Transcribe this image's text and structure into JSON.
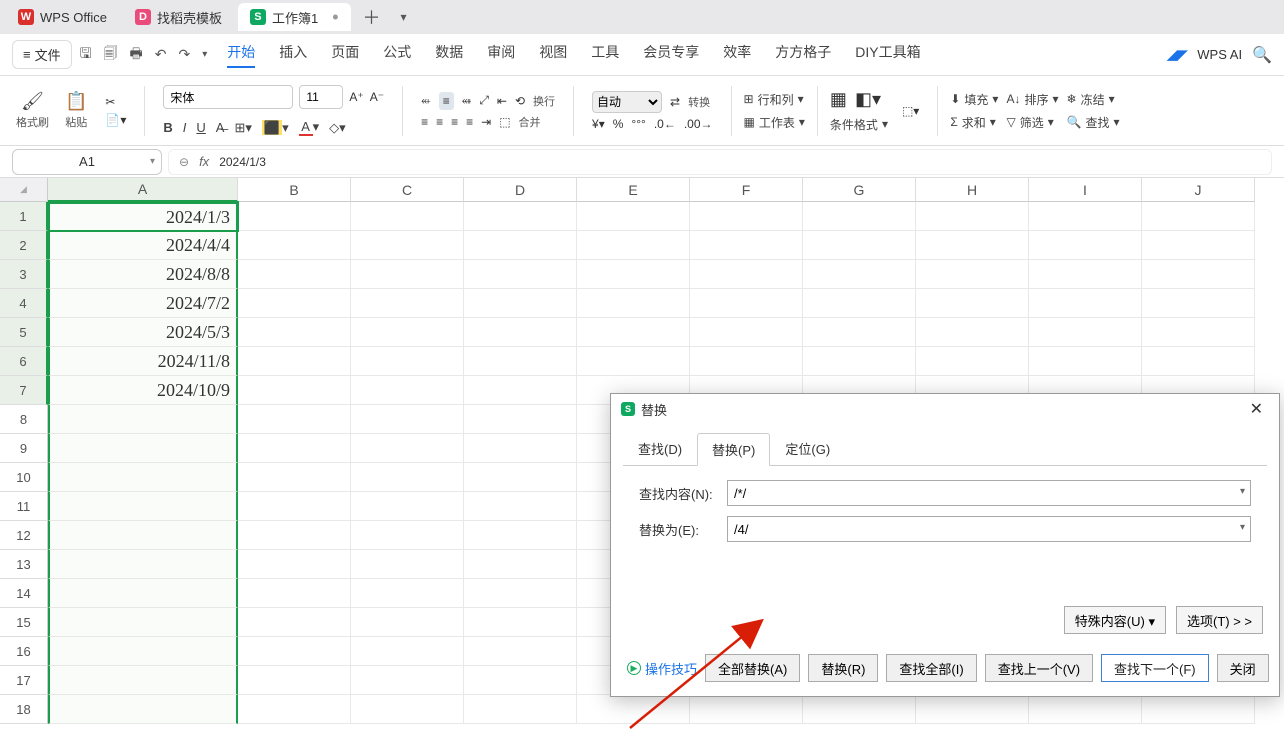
{
  "tabs": {
    "office": "WPS Office",
    "template": "找稻壳模板",
    "workbook": "工作簿1"
  },
  "file_menu": "文件",
  "menus": [
    "开始",
    "插入",
    "页面",
    "公式",
    "数据",
    "审阅",
    "视图",
    "工具",
    "会员专享",
    "效率",
    "方方格子",
    "DIY工具箱"
  ],
  "ai_label": "WPS AI",
  "ribbon": {
    "format_brush": "格式刷",
    "paste": "粘贴",
    "font_name": "宋体",
    "font_size": "11",
    "auto": "自动",
    "wrap": "换行",
    "merge": "合并",
    "convert": "转换",
    "rowcol": "行和列",
    "worksheet": "工作表",
    "cond_fmt": "条件格式",
    "fill": "填充",
    "sort": "排序",
    "freeze": "冻结",
    "sum": "求和",
    "filter": "筛选",
    "find": "查找"
  },
  "cell_ref": "A1",
  "formula": "2024/1/3",
  "columns": [
    "A",
    "B",
    "C",
    "D",
    "E",
    "F",
    "G",
    "H",
    "I",
    "J"
  ],
  "row_count": 18,
  "cells_A": [
    "2024/1/3",
    "2024/4/4",
    "2024/8/8",
    "2024/7/2",
    "2024/5/3",
    "2024/11/8",
    "2024/10/9",
    "",
    "",
    "",
    "",
    "",
    "",
    "",
    "",
    "",
    "",
    ""
  ],
  "chart_data": {
    "type": "table",
    "columns": [
      "A"
    ],
    "rows": [
      [
        "2024/1/3"
      ],
      [
        "2024/4/4"
      ],
      [
        "2024/8/8"
      ],
      [
        "2024/7/2"
      ],
      [
        "2024/5/3"
      ],
      [
        "2024/11/8"
      ],
      [
        "2024/10/9"
      ]
    ]
  },
  "dialog": {
    "title": "替换",
    "tabs": {
      "find": "查找(D)",
      "replace": "替换(P)",
      "goto": "定位(G)"
    },
    "find_label": "查找内容(N):",
    "find_value": "/*/",
    "replace_label": "替换为(E):",
    "replace_value": "/4/",
    "special_btn": "特殊内容(U) ▾",
    "options_btn": "选项(T) > >",
    "tip": "操作技巧",
    "btn_replace_all": "全部替换(A)",
    "btn_replace": "替换(R)",
    "btn_find_all": "查找全部(I)",
    "btn_find_prev": "查找上一个(V)",
    "btn_find_next": "查找下一个(F)",
    "btn_close": "关闭"
  }
}
